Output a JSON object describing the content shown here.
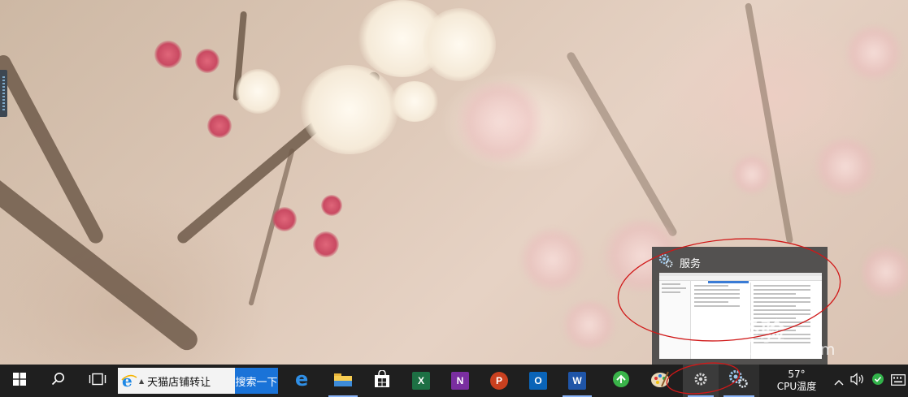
{
  "preview": {
    "title": "服务"
  },
  "watermark": {
    "logo_text": "Bai经验",
    "url": "jingyan.baidu.com"
  },
  "taskbar": {
    "search_text": "天猫店铺转让",
    "search_button": "搜索一下",
    "apps": [
      {
        "name": "edge",
        "icon": "edge-icon"
      },
      {
        "name": "file-explorer",
        "icon": "folder-icon"
      },
      {
        "name": "store",
        "icon": "store-icon"
      },
      {
        "name": "excel",
        "icon": "excel-icon",
        "letter": "X",
        "color": "#1d7044"
      },
      {
        "name": "onenote",
        "icon": "onenote-icon",
        "letter": "N",
        "color": "#7a2ea0"
      },
      {
        "name": "powerpoint",
        "icon": "powerpoint-icon",
        "letter": "P",
        "color": "#c9401f"
      },
      {
        "name": "outlook",
        "icon": "outlook-icon",
        "letter": "O",
        "color": "#0a64b8"
      },
      {
        "name": "word",
        "icon": "word-icon",
        "letter": "W",
        "color": "#1f55a8"
      },
      {
        "name": "green-app",
        "icon": "green-arrow-icon"
      },
      {
        "name": "paint",
        "icon": "palette-icon"
      },
      {
        "name": "services",
        "icon": "gear-icon"
      },
      {
        "name": "services-active",
        "icon": "gears-icon"
      }
    ],
    "cpu_temp_value": "57°",
    "cpu_temp_label": "CPU温度"
  },
  "colors": {
    "taskbar": "#1f1f1f",
    "search_button": "#1a73d8",
    "annotation": "#d01818"
  }
}
